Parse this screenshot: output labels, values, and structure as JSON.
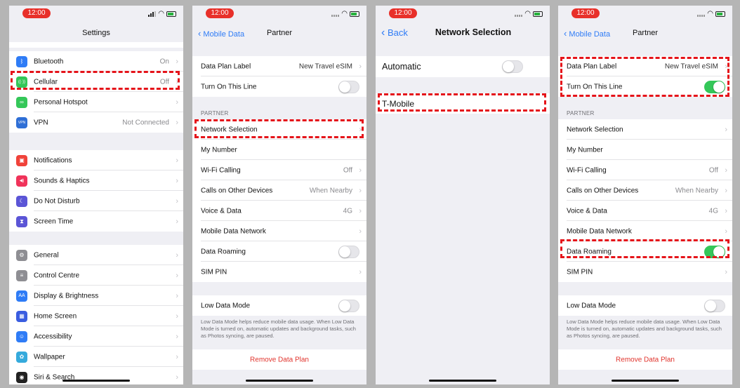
{
  "status": {
    "time": "12:00"
  },
  "panel1": {
    "title": "Settings",
    "rows": [
      {
        "label": "Bluetooth",
        "value": "On",
        "icon": "bluetooth-icon",
        "color": "#2f7cf6"
      },
      {
        "label": "Cellular",
        "value": "Off",
        "icon": "antenna-icon",
        "color": "#34c759"
      },
      {
        "label": "Personal Hotspot",
        "value": "",
        "icon": "hotspot-icon",
        "color": "#34c759"
      },
      {
        "label": "VPN",
        "value": "Not Connected",
        "icon": "vpn-icon",
        "color": "#2f6fd6"
      },
      {
        "label": "Notifications",
        "value": "",
        "icon": "notifications-icon",
        "color": "#f0423a"
      },
      {
        "label": "Sounds & Haptics",
        "value": "",
        "icon": "speaker-icon",
        "color": "#f0335a"
      },
      {
        "label": "Do Not Disturb",
        "value": "",
        "icon": "moon-icon",
        "color": "#5b55d6"
      },
      {
        "label": "Screen Time",
        "value": "",
        "icon": "hourglass-icon",
        "color": "#5b55d6"
      },
      {
        "label": "General",
        "value": "",
        "icon": "gear-icon",
        "color": "#8e8e93"
      },
      {
        "label": "Control Centre",
        "value": "",
        "icon": "switches-icon",
        "color": "#8e8e93"
      },
      {
        "label": "Display & Brightness",
        "value": "",
        "icon": "text-size-icon",
        "color": "#2f7cf6"
      },
      {
        "label": "Home Screen",
        "value": "",
        "icon": "grid-icon",
        "color": "#3a5de0"
      },
      {
        "label": "Accessibility",
        "value": "",
        "icon": "accessibility-icon",
        "color": "#2f7cf6"
      },
      {
        "label": "Wallpaper",
        "value": "",
        "icon": "flower-icon",
        "color": "#35aadc"
      },
      {
        "label": "Siri & Search",
        "value": "",
        "icon": "siri-icon",
        "color": "#222"
      }
    ],
    "icon_glyphs": {
      "bt": "ᛒ",
      "cell": "((·))",
      "hot": "∞",
      "vpn": "VPN",
      "notif": "▣",
      "sound": "◀)",
      "dnd": "☾",
      "st": "⧗",
      "gen": "⚙",
      "cc": "≡",
      "disp": "AA",
      "home": "▦",
      "acc": "☺",
      "wall": "✿",
      "siri": "◉"
    }
  },
  "partner": {
    "back": "Mobile Data",
    "title": "Partner",
    "plan_label": "Data Plan Label",
    "plan_value": "New Travel eSIM",
    "turn_on": "Turn On This Line",
    "section": "PARTNER",
    "network_selection": "Network Selection",
    "my_number": "My Number",
    "wifi_calling": "Wi-Fi Calling",
    "wifi_calling_value": "Off",
    "calls_other": "Calls on Other Devices",
    "calls_other_value": "When Nearby",
    "voice_data": "Voice & Data",
    "voice_data_value": "4G",
    "mobile_network": "Mobile Data Network",
    "data_roaming": "Data Roaming",
    "sim_pin": "SIM PIN",
    "low_data": "Low Data Mode",
    "low_data_footer": "Low Data Mode helps reduce mobile data usage. When Low Data Mode is turned on, automatic updates and background tasks, such as Photos syncing, are paused.",
    "remove": "Remove Data Plan"
  },
  "netsel": {
    "back": "Back",
    "title": "Network Selection",
    "automatic": "Automatic",
    "carrier": "T-Mobile"
  },
  "colors": {
    "accent": "#2f7cf6",
    "toggle_on": "#34c759",
    "highlight": "#e5141a",
    "destructive": "#e0322b"
  },
  "toggles": {
    "panel2_turn_on": false,
    "panel2_roaming": false,
    "panel2_low_data": false,
    "panel3_automatic": false,
    "panel4_turn_on": true,
    "panel4_roaming": true,
    "panel4_low_data": false
  }
}
